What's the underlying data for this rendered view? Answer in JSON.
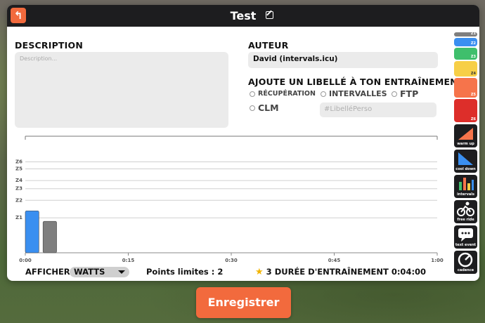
{
  "window": {
    "title": "Test"
  },
  "description": {
    "label": "DESCRIPTION",
    "placeholder": "Description..."
  },
  "author": {
    "label": "AUTEUR",
    "value": "David (intervals.icu)"
  },
  "tags": {
    "label": "AJOUTE UN LIBELLÉ À TON ENTRAÎNEMENT",
    "options": [
      "RÉCUPÉRATION",
      "INTERVALLES",
      "FTP",
      "CLM"
    ],
    "custom_placeholder": "#LibelléPerso"
  },
  "sidebar": {
    "zones": [
      {
        "label": "Z1",
        "color": "#7f7f7f"
      },
      {
        "label": "Z2",
        "color": "#3a8ff0"
      },
      {
        "label": "Z3",
        "color": "#3fbf6c"
      },
      {
        "label": "Z4",
        "color": "#f7cf47"
      },
      {
        "label": "Z5",
        "color": "#f6744b"
      },
      {
        "label": "Z6",
        "color": "#dd2e2a"
      }
    ],
    "tools": [
      {
        "label": "warm up",
        "icon": "warm-up-icon"
      },
      {
        "label": "cool down",
        "icon": "cool-down-icon"
      },
      {
        "label": "intervals",
        "icon": "intervals-icon"
      },
      {
        "label": "free ride",
        "icon": "cyclist-icon"
      },
      {
        "label": "text event",
        "icon": "speech-bubble-icon"
      },
      {
        "label": "cadence",
        "icon": "cadence-icon"
      }
    ]
  },
  "chart_data": {
    "type": "bar",
    "x_ticks": [
      "0:00",
      "0:15",
      "0:30",
      "0:45",
      "1:00"
    ],
    "zone_labels": [
      "Z1",
      "Z2",
      "Z3",
      "Z4",
      "Z5",
      "Z6"
    ],
    "zone_levels": [
      0.3,
      0.45,
      0.55,
      0.62,
      0.72,
      0.78
    ],
    "blocks": [
      {
        "start": 0.0,
        "end": 0.033,
        "level": 0.36,
        "color": "#3a8ff0"
      },
      {
        "start": 0.043,
        "end": 0.076,
        "level": 0.27,
        "color": "#7f7f7f"
      }
    ]
  },
  "footer": {
    "display_label": "AFFICHER",
    "display_value": "WATTS",
    "limit_points": "Points limites : 2",
    "stars": "3",
    "duration": "DURÉE D'ENTRAÎNEMENT 0:04:00"
  },
  "save_button": {
    "label": "Enregistrer"
  }
}
